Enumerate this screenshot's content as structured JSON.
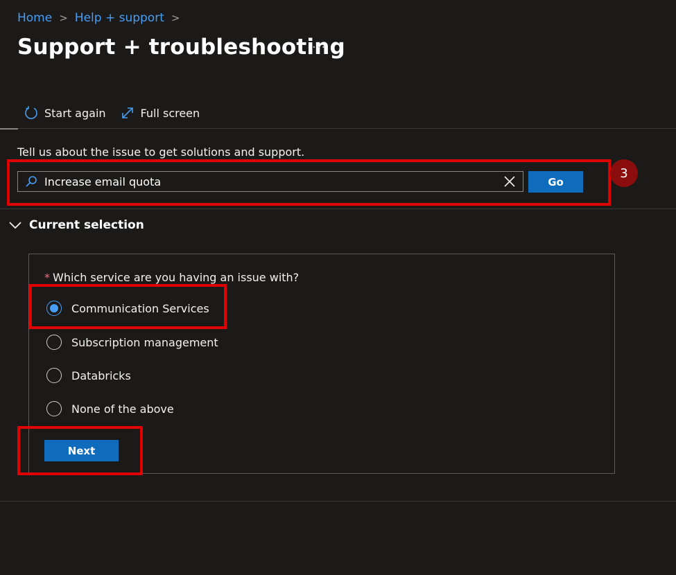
{
  "breadcrumb": {
    "items": [
      "Home",
      "Help + support"
    ],
    "separator": ">"
  },
  "page": {
    "title": "Support + troubleshooting",
    "more": "···"
  },
  "toolbar": {
    "start_again": "Start again",
    "full_screen": "Full screen"
  },
  "intro": "Tell us about the issue to get solutions and support.",
  "search": {
    "value": "Increase email quota",
    "go_label": "Go"
  },
  "annotation": {
    "step_number": "3"
  },
  "current_selection": {
    "title": "Current selection",
    "required_marker": "*",
    "question": "Which service are you having an issue with?",
    "options": [
      {
        "label": "Communication Services",
        "selected": true
      },
      {
        "label": "Subscription management",
        "selected": false
      },
      {
        "label": "Databricks",
        "selected": false
      },
      {
        "label": "None of the above",
        "selected": false
      }
    ],
    "next_label": "Next"
  },
  "colors": {
    "accent": "#0f6cbd",
    "link": "#479ef5",
    "callout": "#e00000"
  }
}
